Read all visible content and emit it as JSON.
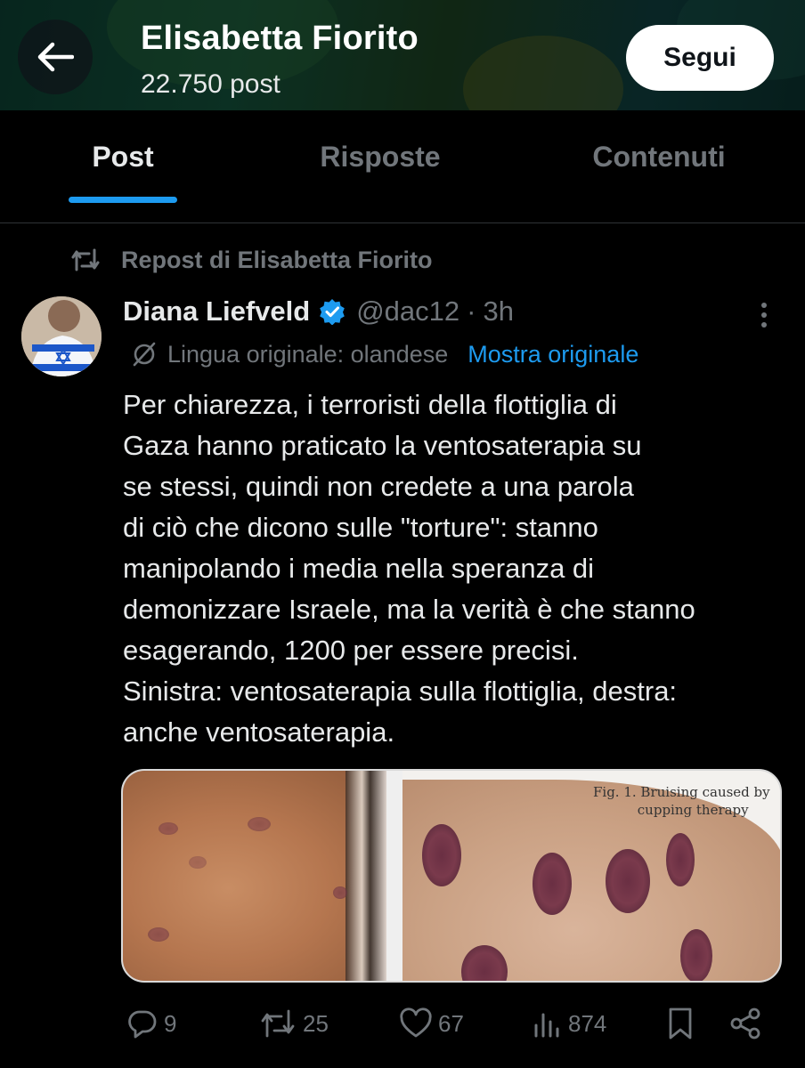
{
  "header": {
    "name": "Elisabetta Fiorito",
    "post_count": "22.750 post",
    "follow_label": "Segui"
  },
  "tabs": [
    {
      "label": "Post",
      "active": true
    },
    {
      "label": "Risposte",
      "active": false
    },
    {
      "label": "Contenuti",
      "active": false
    }
  ],
  "repost": {
    "label": "Repost di Elisabetta Fiorito"
  },
  "tweet": {
    "author_name": "Diana Liefveld",
    "handle": "@dac12",
    "separator": "·",
    "time": "3h",
    "translation_label": "Lingua originale: olandese",
    "show_original": "Mostra originale",
    "text_lines": [
      "Per chiarezza, i terroristi della flottiglia di",
      "Gaza hanno praticato la ventosaterapia su",
      "se stessi, quindi non credete a una parola",
      "di ciò che dicono sulle \"torture\": stanno",
      "manipolando i media nella speranza di",
      "demonizzare Israele, ma la verità è che stanno",
      "esagerando, 1200 per essere precisi.",
      "Sinistra: ventosaterapia sulla flottiglia, destra:",
      "anche ventosaterapia."
    ],
    "media_caption_line1": "Fig. 1. Bruising caused by",
    "media_caption_line2": "cupping therapy"
  },
  "actions": {
    "replies": "9",
    "reposts": "25",
    "likes": "67",
    "views": "874"
  },
  "colors": {
    "accent": "#1d9bf0",
    "muted": "#71767b",
    "text": "#e7e9ea",
    "background": "#000000"
  },
  "icons": [
    "back-arrow-icon",
    "repost-icon",
    "verified-badge-icon",
    "more-icon",
    "translate-icon",
    "reply-icon",
    "like-icon",
    "views-icon",
    "bookmark-icon",
    "share-icon"
  ]
}
